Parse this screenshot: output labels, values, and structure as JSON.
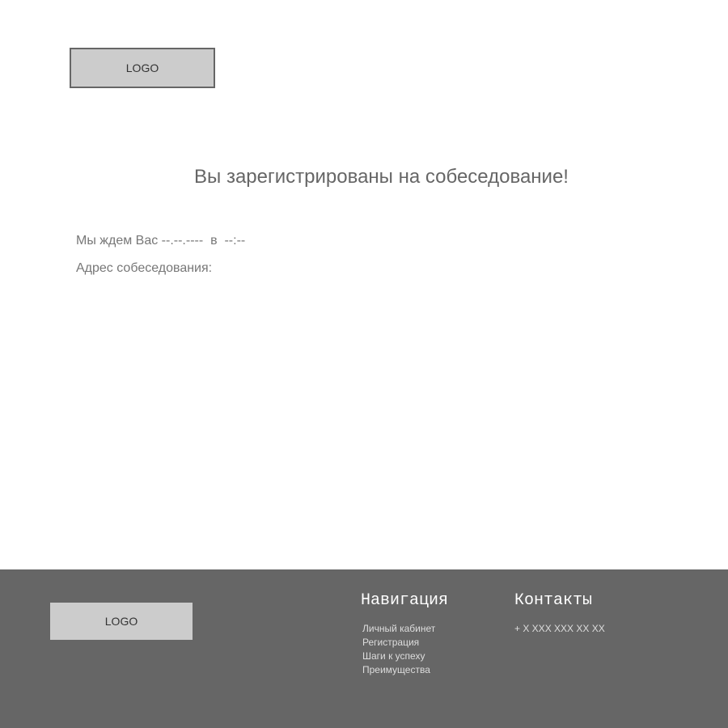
{
  "header": {
    "logo_text": "LOGO"
  },
  "main": {
    "title": "Вы зарегистрированы на собеседование!",
    "date_line": "Мы ждем Вас --.--.----  в  --:--",
    "address_label": "Адрес собеседования:"
  },
  "footer": {
    "logo_text": "LOGO",
    "navigation": {
      "heading": "Навигация",
      "items": [
        {
          "label": "Личный кабинет"
        },
        {
          "label": "Регистрация"
        },
        {
          "label": "Шаги к успеху"
        },
        {
          "label": "Преимущества"
        }
      ]
    },
    "contacts": {
      "heading": "Контакты",
      "phone": "+ X XXX XXX XX XX"
    }
  },
  "colors": {
    "footer_bg": "#666666",
    "logo_bg": "#cccccc",
    "text": "#666666"
  }
}
